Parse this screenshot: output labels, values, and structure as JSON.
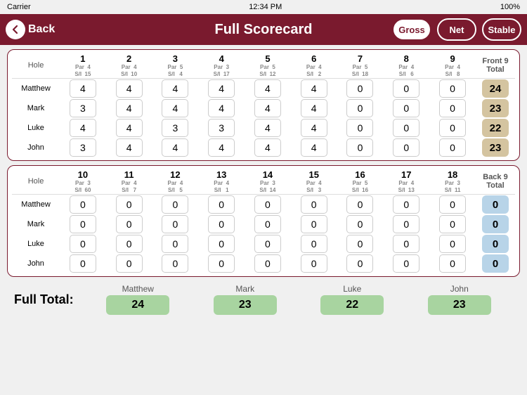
{
  "statusBar": {
    "carrier": "Carrier",
    "time": "12:34 PM",
    "battery": "100%"
  },
  "header": {
    "title": "Full Scorecard",
    "backLabel": "Back",
    "buttons": {
      "gross": "Gross",
      "net": "Net",
      "stable": "Stable"
    }
  },
  "front9": {
    "sectionLabel": "Hole",
    "holes": [
      {
        "num": "1",
        "par": "4",
        "si": "15"
      },
      {
        "num": "2",
        "par": "4",
        "si": "10"
      },
      {
        "num": "3",
        "par": "5",
        "si": "4"
      },
      {
        "num": "4",
        "par": "3",
        "si": "17"
      },
      {
        "num": "5",
        "par": "5",
        "si": "12"
      },
      {
        "num": "6",
        "par": "4",
        "si": "2"
      },
      {
        "num": "7",
        "par": "5",
        "si": "18"
      },
      {
        "num": "8",
        "par": "4",
        "si": "6"
      },
      {
        "num": "9",
        "par": "4",
        "si": "8"
      }
    ],
    "totalLabel": "Front 9\nTotal",
    "players": [
      {
        "name": "Matthew",
        "scores": [
          4,
          4,
          4,
          4,
          4,
          4,
          0,
          0,
          0
        ],
        "total": 24
      },
      {
        "name": "Mark",
        "scores": [
          3,
          4,
          4,
          4,
          4,
          4,
          0,
          0,
          0
        ],
        "total": 23
      },
      {
        "name": "Luke",
        "scores": [
          4,
          4,
          3,
          3,
          4,
          4,
          0,
          0,
          0
        ],
        "total": 22
      },
      {
        "name": "John",
        "scores": [
          3,
          4,
          4,
          4,
          4,
          4,
          0,
          0,
          0
        ],
        "total": 23
      }
    ]
  },
  "back9": {
    "sectionLabel": "Hole",
    "holes": [
      {
        "num": "10",
        "par": "3",
        "si": "60"
      },
      {
        "num": "11",
        "par": "4",
        "si": "7"
      },
      {
        "num": "12",
        "par": "4",
        "si": "5"
      },
      {
        "num": "13",
        "par": "4",
        "si": "1"
      },
      {
        "num": "14",
        "par": "3",
        "si": "14"
      },
      {
        "num": "15",
        "par": "4",
        "si": "3"
      },
      {
        "num": "16",
        "par": "5",
        "si": "16"
      },
      {
        "num": "17",
        "par": "4",
        "si": "13"
      },
      {
        "num": "18",
        "par": "3",
        "si": "11"
      }
    ],
    "totalLabel": "Back 9\nTotal",
    "players": [
      {
        "name": "Matthew",
        "scores": [
          0,
          0,
          0,
          0,
          0,
          0,
          0,
          0,
          0
        ],
        "total": 0
      },
      {
        "name": "Mark",
        "scores": [
          0,
          0,
          0,
          0,
          0,
          0,
          0,
          0,
          0
        ],
        "total": 0
      },
      {
        "name": "Luke",
        "scores": [
          0,
          0,
          0,
          0,
          0,
          0,
          0,
          0,
          0
        ],
        "total": 0
      },
      {
        "name": "John",
        "scores": [
          0,
          0,
          0,
          0,
          0,
          0,
          0,
          0,
          0
        ],
        "total": 0
      }
    ]
  },
  "fullTotals": {
    "label": "Full Total:",
    "players": [
      {
        "name": "Matthew",
        "total": "24"
      },
      {
        "name": "Mark",
        "total": "23"
      },
      {
        "name": "Luke",
        "total": "22"
      },
      {
        "name": "John",
        "total": "23"
      }
    ]
  }
}
